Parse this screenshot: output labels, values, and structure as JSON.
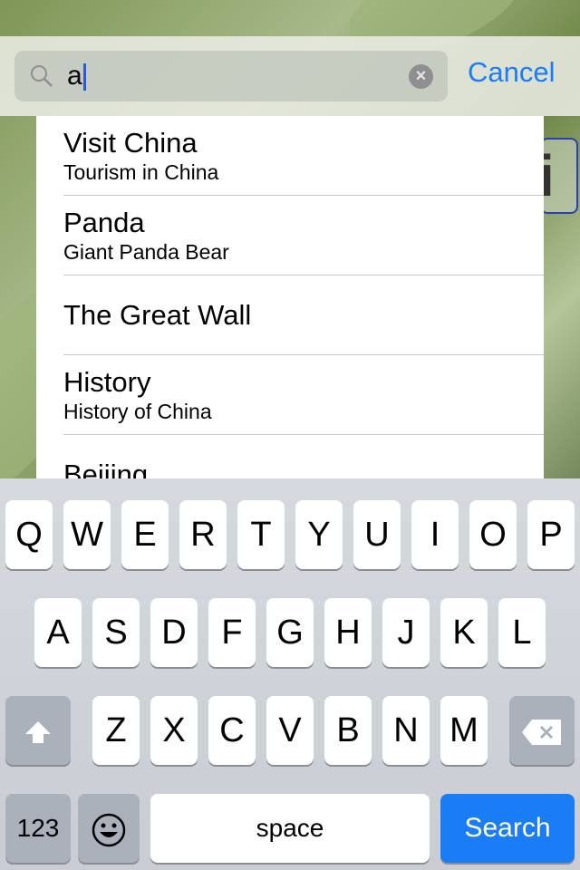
{
  "search": {
    "value": "a",
    "cancel_label": "Cancel"
  },
  "info_button": {
    "glyph": "i"
  },
  "results": [
    {
      "title": "Visit China",
      "subtitle": "Tourism in China"
    },
    {
      "title": "Panda",
      "subtitle": "Giant Panda Bear"
    },
    {
      "title": "The Great Wall",
      "subtitle": ""
    },
    {
      "title": "History",
      "subtitle": "History of China"
    },
    {
      "title": "Beijing",
      "subtitle": ""
    }
  ],
  "keyboard": {
    "row1": [
      "Q",
      "W",
      "E",
      "R",
      "T",
      "Y",
      "U",
      "I",
      "O",
      "P"
    ],
    "row2": [
      "A",
      "S",
      "D",
      "F",
      "G",
      "H",
      "J",
      "K",
      "L"
    ],
    "row3": [
      "Z",
      "X",
      "C",
      "V",
      "B",
      "N",
      "M"
    ],
    "numbers_label": "123",
    "space_label": "space",
    "search_label": "Search",
    "accent": "#1a7df5"
  }
}
